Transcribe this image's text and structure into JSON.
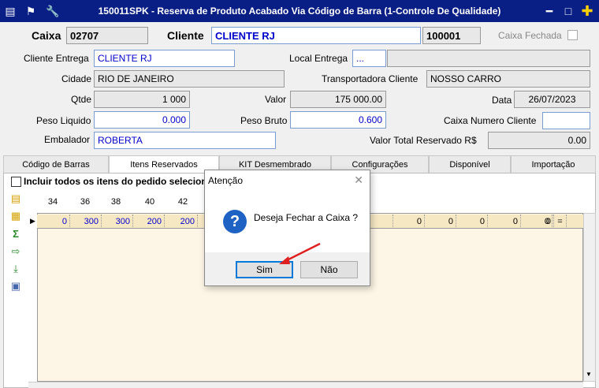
{
  "window": {
    "title": "150011SPK - Reserva de Produto Acabado Via Código de Barra (1-Controle De Qualidade)",
    "min_glyph": "━",
    "max_glyph": "□",
    "add_glyph": "✚"
  },
  "header": {
    "caixa_label": "Caixa",
    "caixa_value": "02707",
    "cliente_label": "Cliente",
    "cliente_value": "CLIENTE RJ",
    "cliente_code": "100001",
    "caixa_fechada_label": "Caixa Fechada"
  },
  "form": {
    "cliente_entrega_label": "Cliente Entrega",
    "cliente_entrega_value": "CLIENTE RJ",
    "local_entrega_label": "Local Entrega",
    "local_entrega_value": "...",
    "cidade_label": "Cidade",
    "cidade_value": "RIO DE JANEIRO",
    "transportadora_label": "Transportadora Cliente",
    "transportadora_value": "NOSSO CARRO",
    "qtde_label": "Qtde",
    "qtde_value": "1 000",
    "valor_label": "Valor",
    "valor_value": "175 000.00",
    "data_label": "Data",
    "data_value": "26/07/2023",
    "peso_liquido_label": "Peso Liquido",
    "peso_liquido_value": "0.000",
    "peso_bruto_label": "Peso Bruto",
    "peso_bruto_value": "0.600",
    "caixa_numero_label": "Caixa Numero Cliente",
    "caixa_numero_value": "",
    "embalador_label": "Embalador",
    "embalador_value": "ROBERTA",
    "valor_total_label": "Valor Total Reservado R$",
    "valor_total_value": "0.00"
  },
  "tabs": [
    {
      "label": "Código de Barras"
    },
    {
      "label": "Itens Reservados"
    },
    {
      "label": "KIT Desmembrado"
    },
    {
      "label": "Configurações"
    },
    {
      "label": "Disponível"
    },
    {
      "label": "Importação"
    }
  ],
  "itens": {
    "incluir_label": "Incluir todos os itens do pedido seleciona",
    "columns": [
      "34",
      "36",
      "38",
      "40",
      "42"
    ],
    "row_values_left": [
      "0",
      "300",
      "300",
      "200",
      "200"
    ],
    "row_values_right": [
      "0",
      "0",
      "0",
      "0",
      "0",
      "0"
    ],
    "row_end": "="
  },
  "dialog": {
    "title": "Atenção",
    "close_glyph": "✕",
    "icon_glyph": "?",
    "message": "Deseja Fechar a Caixa ?",
    "yes_label": "Sim",
    "no_label": "Não"
  }
}
